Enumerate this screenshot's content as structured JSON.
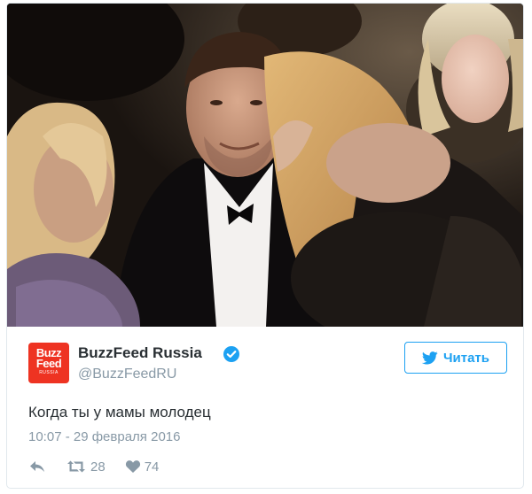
{
  "tweet": {
    "author_name": "BuzzFeed Russia",
    "handle": "@BuzzFeedRU",
    "avatar": {
      "line1": "Buzz",
      "line2": "Feed",
      "line3": "RUSSIA",
      "color": "#ee3322"
    },
    "follow_label": "Читать",
    "text": "Когда ты у мамы молодец",
    "timestamp": "10:07 - 29 февраля 2016",
    "retweets": "28",
    "likes": "74"
  },
  "colors": {
    "accent": "#1da1f2",
    "muted": "#8899a6",
    "text": "#292f33",
    "border": "#e1e8ed"
  },
  "icons": [
    "verified-badge-icon",
    "twitter-bird-icon",
    "reply-icon",
    "retweet-icon",
    "like-heart-icon"
  ]
}
